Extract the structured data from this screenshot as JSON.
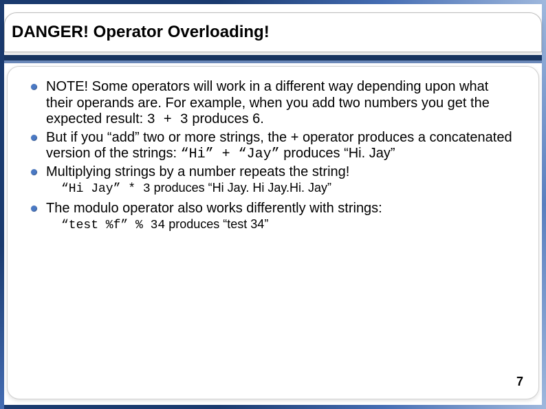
{
  "title": "DANGER! Operator Overloading!",
  "bullets": {
    "b1": {
      "pre": "NOTE! Some operators will work in a different way depending upon what their operands are. For example, when you add two numbers you get the expected result: ",
      "code": "3 + 3",
      "post": " produces 6."
    },
    "b2": {
      "pre": "But if you “add” two or more strings, the + operator produces a concatenated version of the strings: ",
      "code": "“Hi” + “Jay”",
      "post": " produces “Hi. Jay”"
    },
    "b3": {
      "text": "Multiplying strings by a number repeats the string!",
      "sub": {
        "code": "“Hi Jay” * 3",
        "post": " produces “Hi Jay. Hi Jay.Hi. Jay”"
      }
    },
    "b4": {
      "text": "The modulo operator also works differently with strings:",
      "sub": {
        "code": "“test %f” % 34",
        "post": " produces “test 34”"
      }
    }
  },
  "page_number": "7"
}
